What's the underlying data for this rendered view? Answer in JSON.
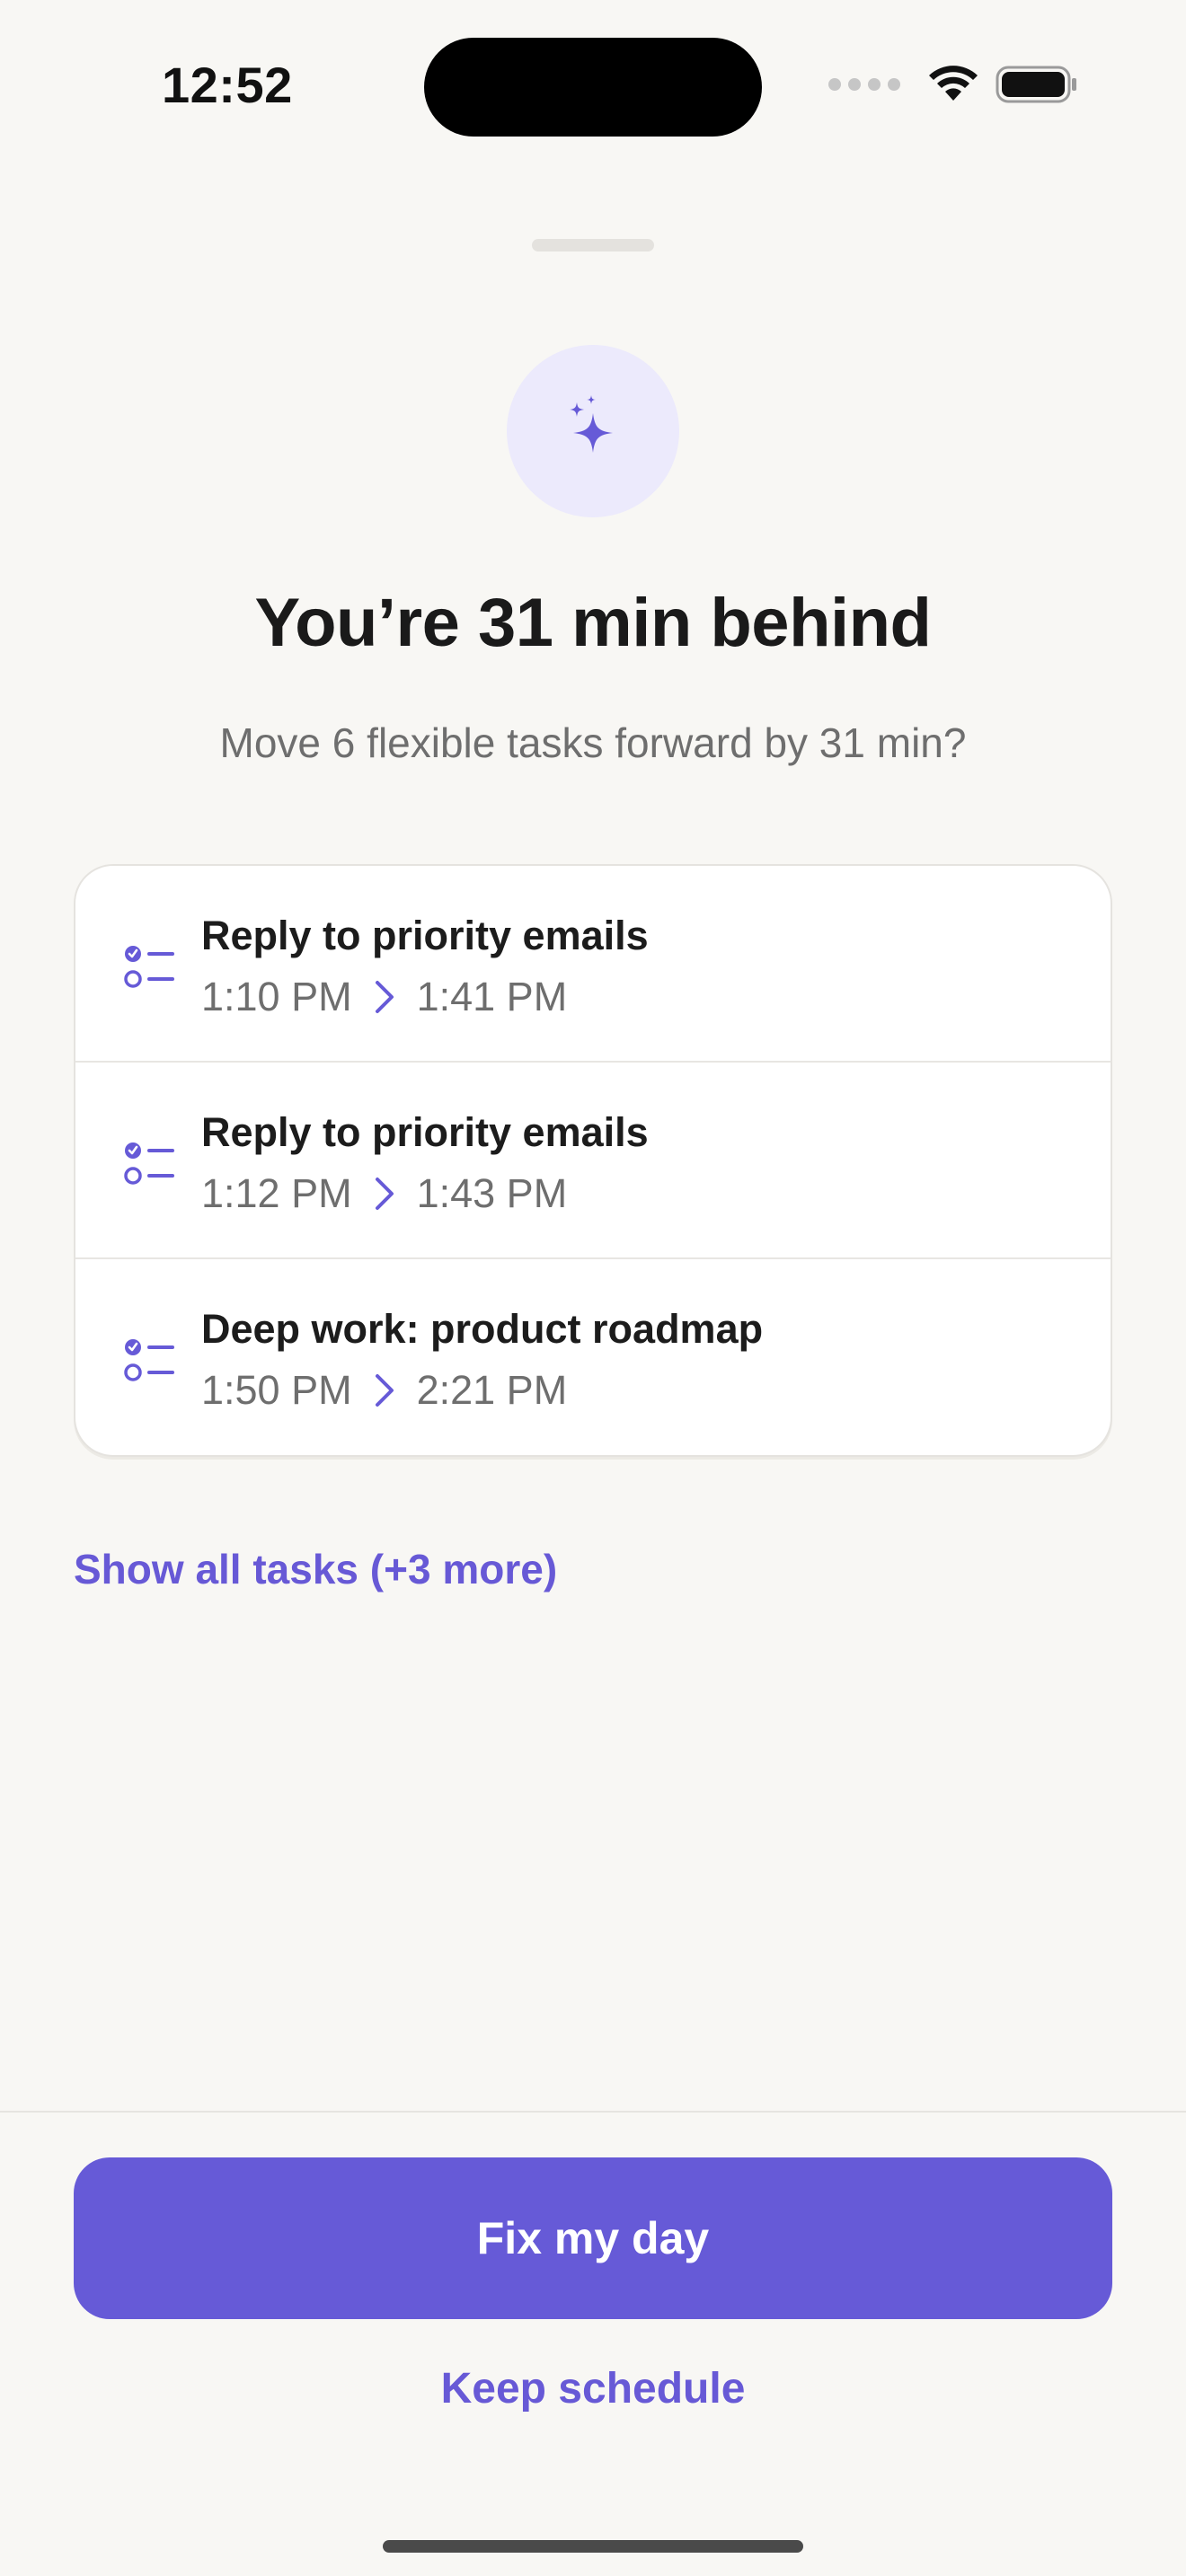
{
  "status_bar": {
    "time": "12:52"
  },
  "sheet": {
    "icon": "sparkles-icon",
    "title": "You’re 31 min behind",
    "subtitle": "Move 6 flexible tasks forward by 31 min?"
  },
  "tasks": [
    {
      "title": "Reply to priority emails",
      "from": "1:10 PM",
      "to": "1:41 PM",
      "icon": "checklist-icon"
    },
    {
      "title": "Reply to priority emails",
      "from": "1:12 PM",
      "to": "1:43 PM",
      "icon": "checklist-icon"
    },
    {
      "title": "Deep work: product roadmap",
      "from": "1:50 PM",
      "to": "2:21 PM",
      "icon": "checklist-icon"
    }
  ],
  "show_all_label": "Show all tasks (+3 more)",
  "actions": {
    "primary_label": "Fix my day",
    "secondary_label": "Keep schedule"
  },
  "colors": {
    "accent": "#665AD7",
    "accent_soft": "#ECEAFC",
    "background": "#F8F7F4"
  }
}
